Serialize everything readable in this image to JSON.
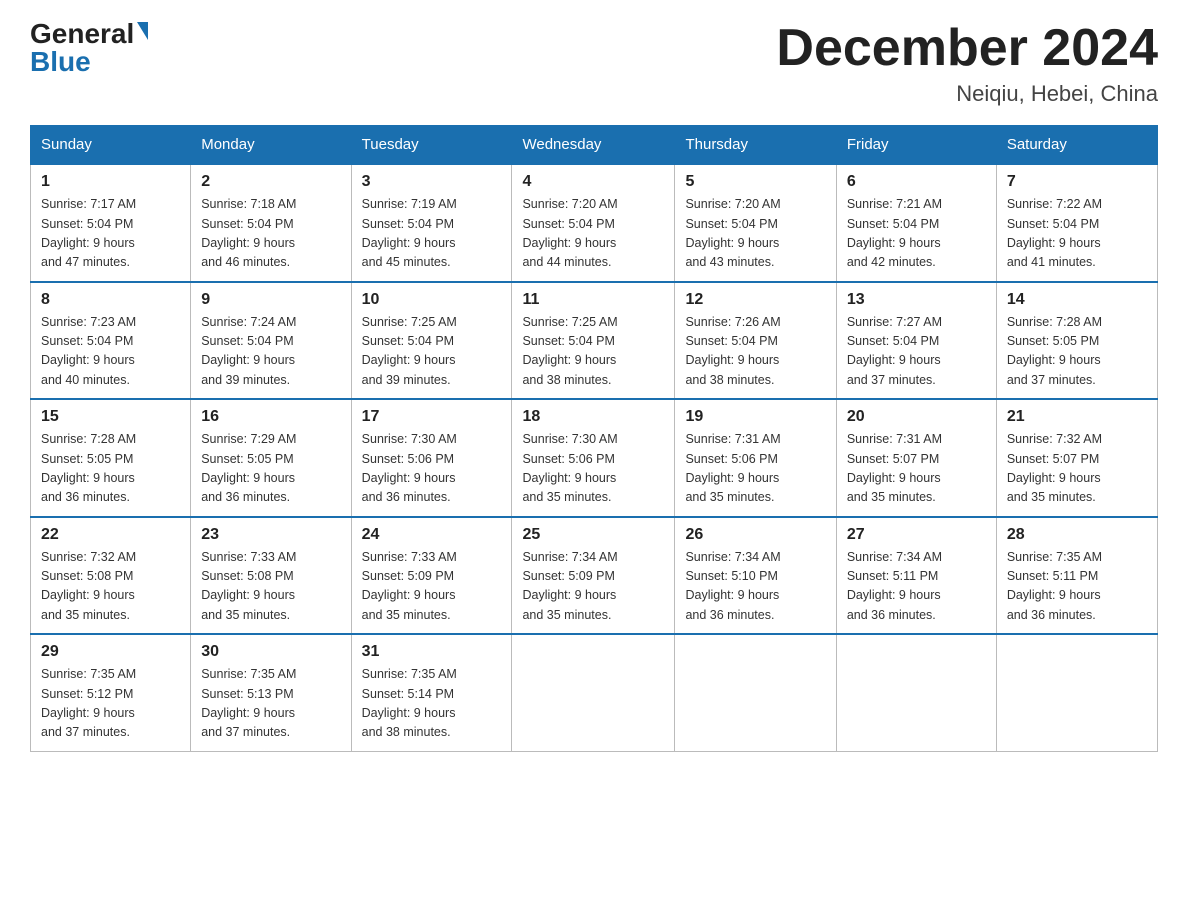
{
  "logo": {
    "general": "General",
    "blue": "Blue"
  },
  "title": "December 2024",
  "subtitle": "Neiqiu, Hebei, China",
  "days_of_week": [
    "Sunday",
    "Monday",
    "Tuesday",
    "Wednesday",
    "Thursday",
    "Friday",
    "Saturday"
  ],
  "weeks": [
    [
      {
        "day": "1",
        "sunrise": "7:17 AM",
        "sunset": "5:04 PM",
        "daylight": "9 hours and 47 minutes."
      },
      {
        "day": "2",
        "sunrise": "7:18 AM",
        "sunset": "5:04 PM",
        "daylight": "9 hours and 46 minutes."
      },
      {
        "day": "3",
        "sunrise": "7:19 AM",
        "sunset": "5:04 PM",
        "daylight": "9 hours and 45 minutes."
      },
      {
        "day": "4",
        "sunrise": "7:20 AM",
        "sunset": "5:04 PM",
        "daylight": "9 hours and 44 minutes."
      },
      {
        "day": "5",
        "sunrise": "7:20 AM",
        "sunset": "5:04 PM",
        "daylight": "9 hours and 43 minutes."
      },
      {
        "day": "6",
        "sunrise": "7:21 AM",
        "sunset": "5:04 PM",
        "daylight": "9 hours and 42 minutes."
      },
      {
        "day": "7",
        "sunrise": "7:22 AM",
        "sunset": "5:04 PM",
        "daylight": "9 hours and 41 minutes."
      }
    ],
    [
      {
        "day": "8",
        "sunrise": "7:23 AM",
        "sunset": "5:04 PM",
        "daylight": "9 hours and 40 minutes."
      },
      {
        "day": "9",
        "sunrise": "7:24 AM",
        "sunset": "5:04 PM",
        "daylight": "9 hours and 39 minutes."
      },
      {
        "day": "10",
        "sunrise": "7:25 AM",
        "sunset": "5:04 PM",
        "daylight": "9 hours and 39 minutes."
      },
      {
        "day": "11",
        "sunrise": "7:25 AM",
        "sunset": "5:04 PM",
        "daylight": "9 hours and 38 minutes."
      },
      {
        "day": "12",
        "sunrise": "7:26 AM",
        "sunset": "5:04 PM",
        "daylight": "9 hours and 38 minutes."
      },
      {
        "day": "13",
        "sunrise": "7:27 AM",
        "sunset": "5:04 PM",
        "daylight": "9 hours and 37 minutes."
      },
      {
        "day": "14",
        "sunrise": "7:28 AM",
        "sunset": "5:05 PM",
        "daylight": "9 hours and 37 minutes."
      }
    ],
    [
      {
        "day": "15",
        "sunrise": "7:28 AM",
        "sunset": "5:05 PM",
        "daylight": "9 hours and 36 minutes."
      },
      {
        "day": "16",
        "sunrise": "7:29 AM",
        "sunset": "5:05 PM",
        "daylight": "9 hours and 36 minutes."
      },
      {
        "day": "17",
        "sunrise": "7:30 AM",
        "sunset": "5:06 PM",
        "daylight": "9 hours and 36 minutes."
      },
      {
        "day": "18",
        "sunrise": "7:30 AM",
        "sunset": "5:06 PM",
        "daylight": "9 hours and 35 minutes."
      },
      {
        "day": "19",
        "sunrise": "7:31 AM",
        "sunset": "5:06 PM",
        "daylight": "9 hours and 35 minutes."
      },
      {
        "day": "20",
        "sunrise": "7:31 AM",
        "sunset": "5:07 PM",
        "daylight": "9 hours and 35 minutes."
      },
      {
        "day": "21",
        "sunrise": "7:32 AM",
        "sunset": "5:07 PM",
        "daylight": "9 hours and 35 minutes."
      }
    ],
    [
      {
        "day": "22",
        "sunrise": "7:32 AM",
        "sunset": "5:08 PM",
        "daylight": "9 hours and 35 minutes."
      },
      {
        "day": "23",
        "sunrise": "7:33 AM",
        "sunset": "5:08 PM",
        "daylight": "9 hours and 35 minutes."
      },
      {
        "day": "24",
        "sunrise": "7:33 AM",
        "sunset": "5:09 PM",
        "daylight": "9 hours and 35 minutes."
      },
      {
        "day": "25",
        "sunrise": "7:34 AM",
        "sunset": "5:09 PM",
        "daylight": "9 hours and 35 minutes."
      },
      {
        "day": "26",
        "sunrise": "7:34 AM",
        "sunset": "5:10 PM",
        "daylight": "9 hours and 36 minutes."
      },
      {
        "day": "27",
        "sunrise": "7:34 AM",
        "sunset": "5:11 PM",
        "daylight": "9 hours and 36 minutes."
      },
      {
        "day": "28",
        "sunrise": "7:35 AM",
        "sunset": "5:11 PM",
        "daylight": "9 hours and 36 minutes."
      }
    ],
    [
      {
        "day": "29",
        "sunrise": "7:35 AM",
        "sunset": "5:12 PM",
        "daylight": "9 hours and 37 minutes."
      },
      {
        "day": "30",
        "sunrise": "7:35 AM",
        "sunset": "5:13 PM",
        "daylight": "9 hours and 37 minutes."
      },
      {
        "day": "31",
        "sunrise": "7:35 AM",
        "sunset": "5:14 PM",
        "daylight": "9 hours and 38 minutes."
      },
      null,
      null,
      null,
      null
    ]
  ],
  "labels": {
    "sunrise": "Sunrise:",
    "sunset": "Sunset:",
    "daylight": "Daylight:"
  }
}
